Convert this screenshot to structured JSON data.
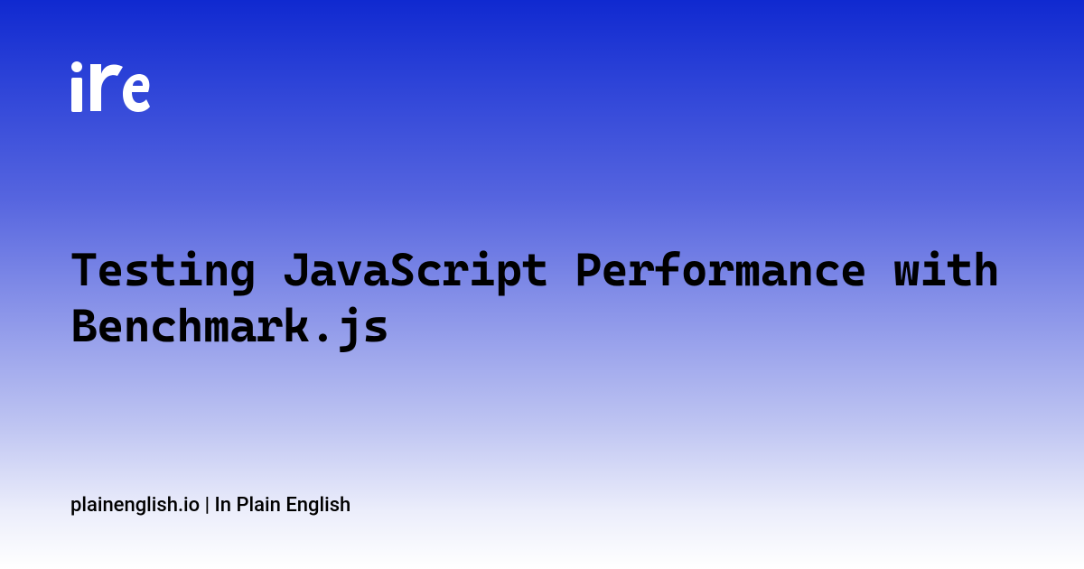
{
  "title": "Testing JavaScript Performance with Benchmark.js",
  "footer": "plainenglish.io | In Plain English",
  "logo_name": "ipe-logo"
}
